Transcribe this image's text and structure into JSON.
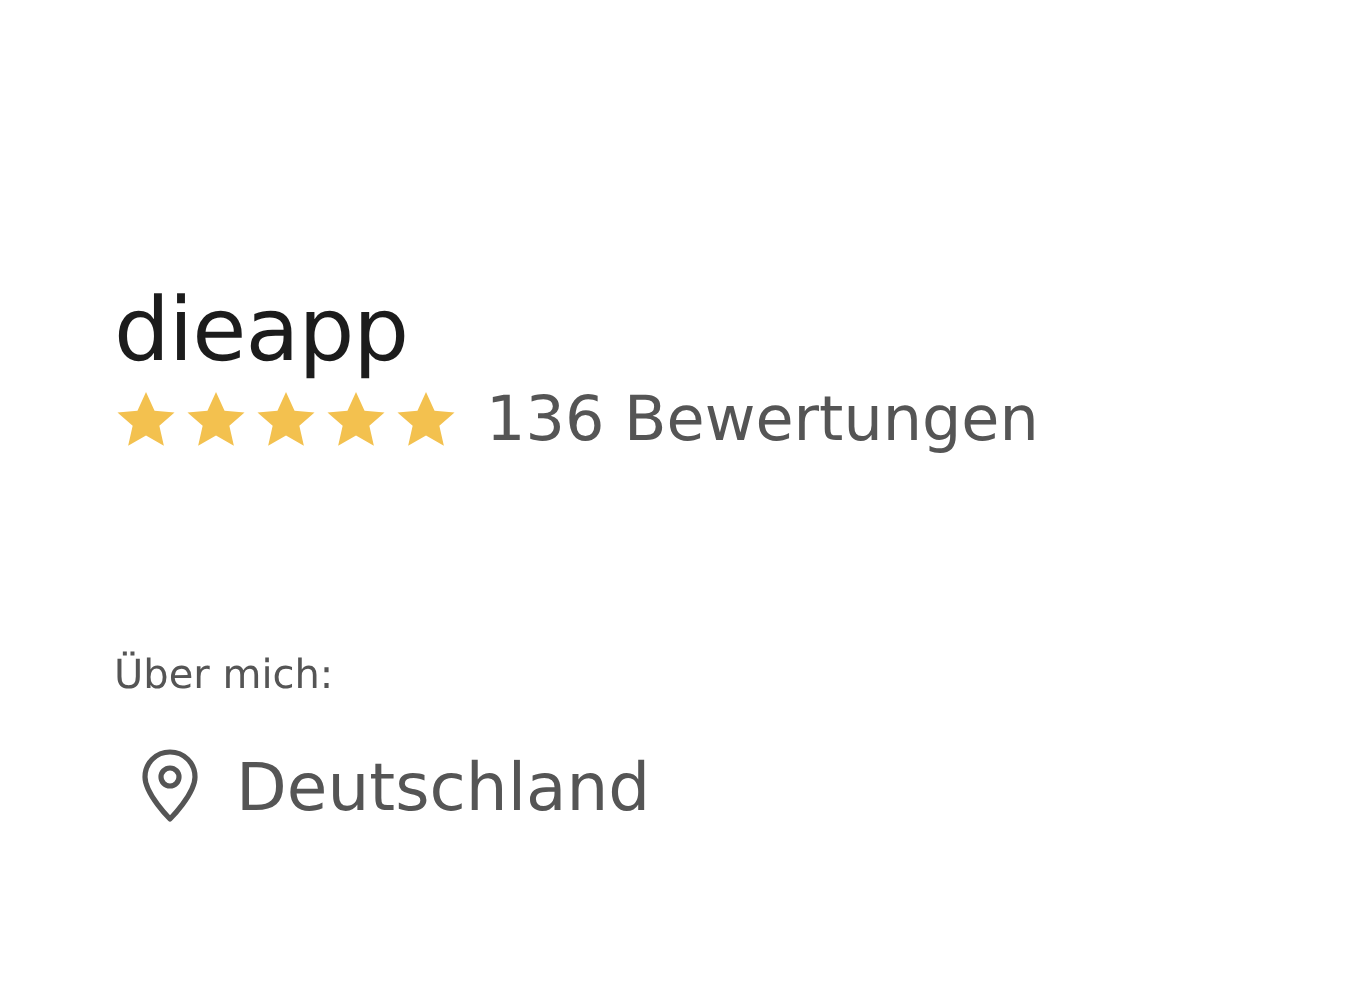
{
  "profile": {
    "name": "dieapp",
    "stars": 5,
    "reviews": "136 Bewertungen"
  },
  "about": {
    "label": "Über mich:",
    "location": "Deutschland"
  }
}
